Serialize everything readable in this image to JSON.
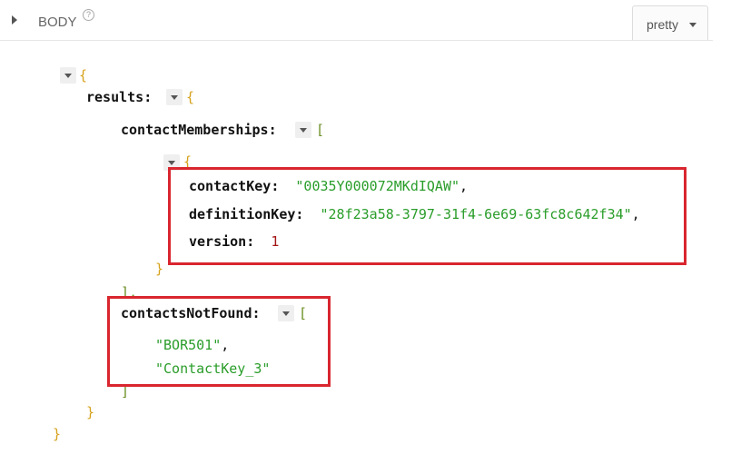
{
  "header": {
    "section_label": "BODY",
    "help_glyph": "?",
    "format_selected": "pretty"
  },
  "json_view": {
    "open_brace": "{",
    "close_brace": "}",
    "open_bracket": "[",
    "close_bracket": "]",
    "close_bracket_comma": "],",
    "colon": ":",
    "comma": ",",
    "results_key": "results",
    "contact_memberships_key": "contactMemberships",
    "contact_key_key": "contactKey",
    "contact_key_value": "\"0035Y000072MKdIQAW\"",
    "definition_key_key": "definitionKey",
    "definition_key_value": "\"28f23a58-3797-31f4-6e69-63fc8c642f34\"",
    "version_key": "version",
    "version_value": "1",
    "contacts_not_found_key": "contactsNotFound",
    "not_found_items": [
      "\"BOR501\"",
      "\"ContactKey_3\""
    ]
  },
  "colors": {
    "highlight_border": "#d9262f",
    "string_value": "#2a9d2a",
    "number_value": "#a31515",
    "brace": "#d6a21c",
    "bracket": "#6b8e23"
  }
}
